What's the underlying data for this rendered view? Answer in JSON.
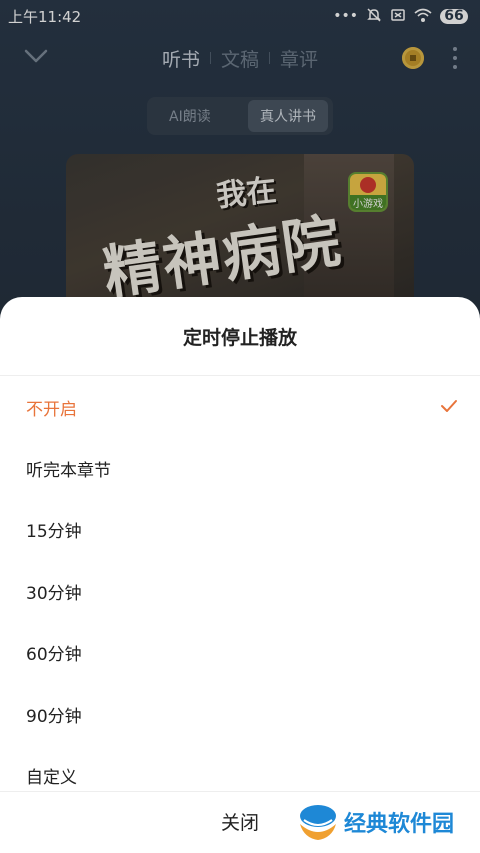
{
  "status_bar": {
    "time": "上午11:42",
    "battery_level": "66",
    "icons": [
      "dots-icon",
      "mute-icon",
      "sim-off-icon",
      "wifi-icon",
      "battery-icon"
    ]
  },
  "player": {
    "tabs": [
      {
        "label": "听书",
        "active": true
      },
      {
        "label": "文稿",
        "active": false
      },
      {
        "label": "章评",
        "active": false
      }
    ],
    "modes": [
      {
        "label": "AI朗读",
        "active": false
      },
      {
        "label": "真人讲书",
        "active": true
      }
    ],
    "cover": {
      "title_line1": "我在",
      "title_line2": "精神病院",
      "badge_label": "小游戏"
    }
  },
  "sheet": {
    "title": "定时停止播放",
    "options": [
      {
        "label": "不开启",
        "selected": true
      },
      {
        "label": "听完本章节",
        "selected": false
      },
      {
        "label": "15分钟",
        "selected": false
      },
      {
        "label": "30分钟",
        "selected": false
      },
      {
        "label": "60分钟",
        "selected": false
      },
      {
        "label": "90分钟",
        "selected": false
      },
      {
        "label": "自定义",
        "selected": false
      }
    ],
    "close_label": "关闭",
    "accent_color": "#e8743b"
  },
  "watermark": {
    "text": "经典软件园"
  }
}
